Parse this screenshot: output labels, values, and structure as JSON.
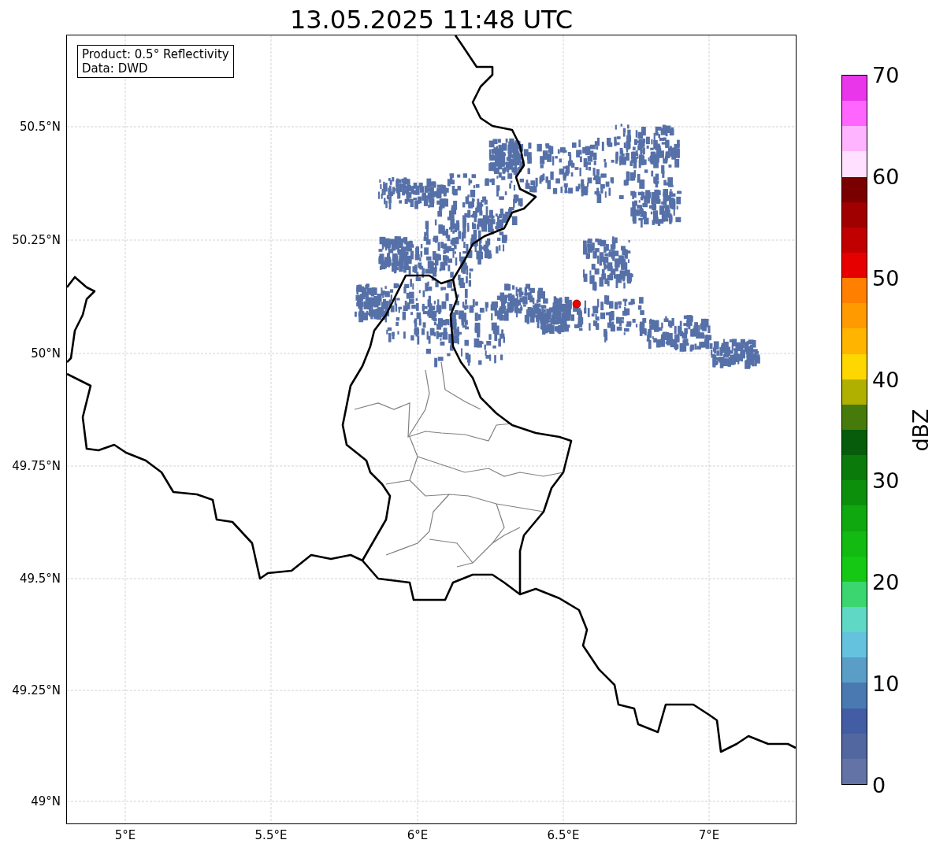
{
  "title": "13.05.2025 11:48 UTC",
  "map": {
    "legend": [
      "Product: 0.5° Reflectivity",
      "Data: DWD"
    ],
    "y_ticks": [
      "50.5°N",
      "50.25°N",
      "50°N",
      "49.75°N",
      "49.5°N",
      "49.25°N",
      "49°N"
    ],
    "x_ticks": [
      "5°E",
      "5.5°E",
      "6°E",
      "6.5°E",
      "7°E"
    ]
  },
  "colorbar": {
    "label": "dBZ",
    "ticks": [
      "70",
      "60",
      "50",
      "40",
      "30",
      "20",
      "10",
      "0"
    ],
    "bands": [
      {
        "color": "#e936ea"
      },
      {
        "color": "#ff66ff"
      },
      {
        "color": "#ffb4ff"
      },
      {
        "color": "#ffe0ff"
      },
      {
        "color": "#7a0000"
      },
      {
        "color": "#a00000"
      },
      {
        "color": "#c00000"
      },
      {
        "color": "#e60000"
      },
      {
        "color": "#ff7f00"
      },
      {
        "color": "#ff9a00"
      },
      {
        "color": "#ffb400"
      },
      {
        "color": "#ffd700"
      },
      {
        "color": "#b0b000"
      },
      {
        "color": "#467a0a"
      },
      {
        "color": "#065c0a"
      },
      {
        "color": "#0a7a0a"
      },
      {
        "color": "#0c900c"
      },
      {
        "color": "#0fa80f"
      },
      {
        "color": "#12ba12"
      },
      {
        "color": "#14c814"
      },
      {
        "color": "#3cd670"
      },
      {
        "color": "#60d8c6"
      },
      {
        "color": "#64c2de"
      },
      {
        "color": "#5a9ec8"
      },
      {
        "color": "#4a78b0"
      },
      {
        "color": "#425da3"
      },
      {
        "color": "#5267a0"
      },
      {
        "color": "#6473a6"
      }
    ]
  }
}
